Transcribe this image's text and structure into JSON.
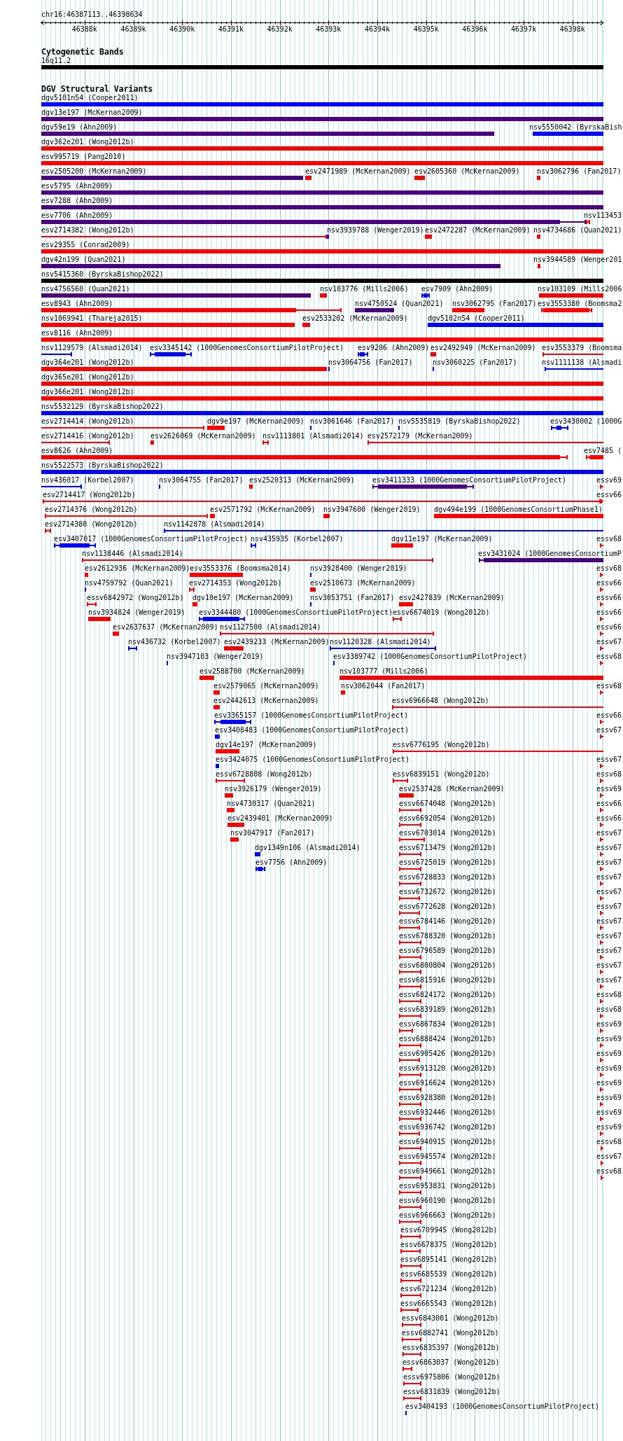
{
  "locus": "chr16:46387113..46398634",
  "ruler_ticks": [
    "46388k",
    "46389k",
    "46390k",
    "46391k",
    "46392k",
    "46393k",
    "46394k",
    "46395k",
    "46396k",
    "46397k",
    "46398k"
  ],
  "tracks": [
    {
      "title": "Cytogenetic Bands",
      "rows": [
        [
          {
            "label": "16q11.2",
            "color": "#000000",
            "kind": "bar"
          }
        ]
      ]
    },
    {
      "title": "DGV Structural Variants",
      "rows": [
        [
          {
            "label": "dgv5101n54 (Cooper2011)",
            "color": "#0000ff",
            "kind": "bar"
          }
        ],
        [
          {
            "label": "dgv13e197 (McKernan2009)",
            "color": "#4b0082",
            "kind": "bar"
          }
        ],
        [
          {
            "label": "dgv59e19 (Ahn2009)",
            "color": "#4b0082",
            "kind": "bar"
          },
          {
            "label": "nsv5550042 (ByrskaBish",
            "color": "#0000ff",
            "kind": "bar"
          }
        ],
        [
          {
            "label": "dgv362e201 (Wong2012b)",
            "color": "#ff0000",
            "kind": "bar"
          }
        ],
        [
          {
            "label": "esv995719 (Pang2010)",
            "color": "#ff0000",
            "kind": "bar"
          }
        ],
        [
          {
            "label": "esv2505200 (McKernan2009)",
            "color": "#4b0082",
            "kind": "bar"
          },
          {
            "label": "esv2471989 (McKernan2009)",
            "color": "#ff0000",
            "kind": "bar"
          },
          {
            "label": "esv2605360 (McKernan2009)",
            "color": "#ff0000",
            "kind": "bar"
          },
          {
            "label": "nsv3062796 (Fan2017)",
            "color": "#ff0000",
            "kind": "bar"
          }
        ],
        [
          {
            "label": "esv5795 (Ahn2009)",
            "color": "#4b0082",
            "kind": "bar"
          }
        ],
        [
          {
            "label": "esv7288 (Ahn2009)",
            "color": "#4b0082",
            "kind": "bar"
          }
        ],
        [
          {
            "label": "esv7706 (Ahn2009)",
            "color": "#4b0082",
            "kind": "mixed"
          },
          {
            "label": "nsv113453",
            "color": "#ff0000",
            "kind": "span"
          }
        ],
        [
          {
            "label": "esv2714382 (Wong2012b)",
            "color": "#ff0000",
            "kind": "span"
          },
          {
            "label": "nsv3939788 (Wenger2019)",
            "color": "#0000ff",
            "kind": "bar"
          },
          {
            "label": "esv2472287 (McKernan2009)",
            "color": "#ff0000",
            "kind": "bar"
          },
          {
            "label": "nsv4734686 (Quan2021)",
            "color": "#ff0000",
            "kind": "bar"
          }
        ],
        [
          {
            "label": "esv29355 (Conrad2009)",
            "color": "#ff0000",
            "kind": "bar"
          }
        ],
        [
          {
            "label": "dgv42n199 (Quan2021)",
            "color": "#4b0082",
            "kind": "bar"
          },
          {
            "label": "nsv3944589 (Wenger201",
            "color": "#ff0000",
            "kind": "bar"
          }
        ],
        [
          {
            "label": "nsv5415360 (ByrskaBishop2022)",
            "color": "#000000",
            "kind": "bar"
          }
        ],
        [
          {
            "label": "nsv4756560 (Quan2021)",
            "color": "#4b0082",
            "kind": "bar"
          },
          {
            "label": "nsv103776 (Mills2006)",
            "color": "#ff0000",
            "kind": "bar"
          },
          {
            "label": "esv7909 (Ahn2009)",
            "color": "#0000ff",
            "kind": "mixed"
          },
          {
            "label": "nsv103109 (Mills2006",
            "color": "#ff0000",
            "kind": "bar"
          }
        ],
        [
          {
            "label": "esv8943 (Ahn2009)",
            "color": "#ff0000",
            "kind": "mixed"
          },
          {
            "label": "nsv4750524 (Quan2021)",
            "color": "#4b0082",
            "kind": "bar"
          },
          {
            "label": "nsv3062795 (Fan2017)",
            "color": "#ff0000",
            "kind": "bar"
          },
          {
            "label": "esv3553380 (Boomsma2",
            "color": "#ff0000",
            "kind": "mixed"
          }
        ],
        [
          {
            "label": "nsv1069941 (Thareja2015)",
            "color": "#ff0000",
            "kind": "bar"
          },
          {
            "label": "esv2533202 (McKernan2009)",
            "color": "#ff0000",
            "kind": "bar"
          },
          {
            "label": "dgv5102n54 (Cooper2011)",
            "color": "#0000ff",
            "kind": "bar"
          }
        ],
        [
          {
            "label": "esv8116 (Ahn2009)",
            "color": "#ff0000",
            "kind": "bar"
          }
        ],
        [
          {
            "label": "nsv1129579 (Alsmadi2014)",
            "color": "#0000ff",
            "kind": "span"
          },
          {
            "label": "esv3345142 (1000GenomesConsortiumPilotProject)",
            "color": "#0000ff",
            "kind": "mixed"
          },
          {
            "label": "esv9206 (Ahn2009)",
            "color": "#0000ff",
            "kind": "mixed"
          },
          {
            "label": "esv2492949 (McKernan2009)",
            "color": "#ff0000",
            "kind": "bar"
          },
          {
            "label": "esv3553379 (Boomsma",
            "color": "#ff0000",
            "kind": "span"
          }
        ],
        [
          {
            "label": "dgv364e201 (Wong2012b)",
            "color": "#ff0000",
            "kind": "bar"
          },
          {
            "label": "nsv3064756 (Fan2017)",
            "color": "#0000ff",
            "kind": "bar"
          },
          {
            "label": "nsv3060225 (Fan2017)",
            "color": "#0000ff",
            "kind": "bar"
          },
          {
            "label": "nsv1111138 (Alsmadi",
            "color": "#0000ff",
            "kind": "span"
          }
        ],
        [
          {
            "label": "dgv365e201 (Wong2012b)",
            "color": "#ff0000",
            "kind": "bar"
          }
        ],
        [
          {
            "label": "dgv366e201 (Wong2012b)",
            "color": "#ff0000",
            "kind": "bar"
          }
        ],
        [
          {
            "label": "nsv5532129 (ByrskaBishop2022)",
            "color": "#0000ff",
            "kind": "bar"
          }
        ],
        [
          {
            "label": "esv2714414 (Wong2012b)",
            "color": "#ff0000",
            "kind": "span"
          },
          {
            "label": "dgv9e197 (McKernan2009)",
            "color": "#ff0000",
            "kind": "bar"
          },
          {
            "label": "nsv3061646 (Fan2017)",
            "color": "#0000ff",
            "kind": "bar"
          },
          {
            "label": "nsv5535819 (ByrskaBishop2022)",
            "color": "#0000ff",
            "kind": "bar"
          },
          {
            "label": "esv3430002 (1000G",
            "color": "#0000ff",
            "kind": "mixed"
          }
        ],
        [
          {
            "label": "esv2714416 (Wong2012b)",
            "color": "#ff0000",
            "kind": "span"
          },
          {
            "label": "esv2626069 (McKernan2009)",
            "color": "#ff0000",
            "kind": "bar"
          },
          {
            "label": "nsv1113801 (Alsmadi2014)",
            "color": "#ff0000",
            "kind": "span"
          },
          {
            "label": "esv2572179 (McKernan2009)",
            "color": "#ff0000",
            "kind": "span"
          }
        ],
        [
          {
            "label": "esv8626 (Ahn2009)",
            "color": "#ff0000",
            "kind": "mixed"
          },
          {
            "label": "esv7485 (",
            "color": "#ff0000",
            "kind": "mixed"
          }
        ],
        [
          {
            "label": "nsv5522573 (ByrskaBishop2022)",
            "color": "#0000ff",
            "kind": "bar"
          }
        ],
        [
          {
            "label": "nsv436017 (Korbel2007)",
            "color": "#0000ff",
            "kind": "span"
          },
          {
            "label": "nsv3064755 (Fan2017)",
            "color": "#0000ff",
            "kind": "bar"
          },
          {
            "label": "esv2520313 (McKernan2009)",
            "color": "#ff0000",
            "kind": "bar"
          },
          {
            "label": "esv3411333 (1000GenomesConsortiumPilotProject)",
            "color": "#4b0082",
            "kind": "mixed"
          },
          {
            "label": "essv69",
            "color": "#ff0000",
            "kind": "span"
          }
        ],
        [
          {
            "label": "esv2714417 (Wong2012b)",
            "color": "#ff0000",
            "kind": "span"
          },
          {
            "label": "essv66",
            "color": "#ff0000",
            "kind": "span"
          }
        ],
        [
          {
            "label": "esv2714376 (Wong2012b)",
            "color": "#ff0000",
            "kind": "span"
          },
          {
            "label": "esv2571792 (McKernan2009)",
            "color": "#ff0000",
            "kind": "bar"
          },
          {
            "label": "nsv3947600 (Wenger2019)",
            "color": "#ff0000",
            "kind": "bar"
          },
          {
            "label": "dgv494e199 (1000GenomesConsortiumPhase1)",
            "color": "#ff0000",
            "kind": "bar"
          }
        ],
        [
          {
            "label": "esv2714380 (Wong2012b)",
            "color": "#ff0000",
            "kind": "span"
          },
          {
            "label": "nsv1142878 (Alsmadi2014)",
            "color": "#0000ff",
            "kind": "span"
          }
        ],
        [
          {
            "label": "esv3407017 (1000GenomesConsortiumPilotProject)",
            "color": "#0000ff",
            "kind": "mixed"
          },
          {
            "label": "nsv435935 (Korbel2007)",
            "color": "#0000ff",
            "kind": "span"
          },
          {
            "label": "dgv11e197 (McKernan2009)",
            "color": "#ff0000",
            "kind": "bar"
          },
          {
            "label": "essv68",
            "color": "#ff0000",
            "kind": "span"
          }
        ],
        [
          {
            "label": "nsv1138446 (Alsmadi2014)",
            "color": "#ff0000",
            "kind": "span"
          },
          {
            "label": "esv3431024 (1000GenomesConsortiumP",
            "color": "#4b0082",
            "kind": "mixed"
          }
        ],
        [
          {
            "label": "esv2612936 (McKernan2009)",
            "color": "#ff0000",
            "kind": "bar"
          },
          {
            "label": "esv3553376 (Boomsma2014)",
            "color": "#ff0000",
            "kind": "bar"
          },
          {
            "label": "nsv3928400 (Wenger2019)",
            "color": "#0000ff",
            "kind": "bar"
          },
          {
            "label": "essv68",
            "color": "#ff0000",
            "kind": "span"
          }
        ],
        [
          {
            "label": "nsv4759792 (Quan2021)",
            "color": "#0000ff",
            "kind": "bar"
          },
          {
            "label": "esv2714353 (Wong2012b)",
            "color": "#ff0000",
            "kind": "span"
          },
          {
            "label": "esv2510673 (McKernan2009)",
            "color": "#ff0000",
            "kind": "bar"
          },
          {
            "label": "essv66",
            "color": "#ff0000",
            "kind": "span"
          }
        ],
        [
          {
            "label": "essv6842972 (Wong2012b)",
            "color": "#ff0000",
            "kind": "span"
          },
          {
            "label": "dgv10e197 (McKernan2009)",
            "color": "#ff0000",
            "kind": "bar"
          },
          {
            "label": "nsv3053751 (Fan2017)",
            "color": "#0000ff",
            "kind": "bar"
          },
          {
            "label": "esv2427839 (McKernan2009)",
            "color": "#ff0000",
            "kind": "bar"
          },
          {
            "label": "essv66",
            "color": "#ff0000",
            "kind": "span"
          }
        ],
        [
          {
            "label": "nsv3934824 (Wenger2019)",
            "color": "#ff0000",
            "kind": "bar"
          },
          {
            "label": "esv3344480 (1000GenomesConsortiumPilotProject)",
            "color": "#0000ff",
            "kind": "mixed"
          },
          {
            "label": "essv6674019 (Wong2012b)",
            "color": "#ff0000",
            "kind": "span"
          },
          {
            "label": "essv66",
            "color": "#ff0000",
            "kind": "span"
          }
        ],
        [
          {
            "label": "esv2637637 (McKernan2009)",
            "color": "#ff0000",
            "kind": "bar"
          },
          {
            "label": "nsv1127500 (Alsmadi2014)",
            "color": "#ff0000",
            "kind": "span"
          },
          {
            "label": "essv66",
            "color": "#ff0000",
            "kind": "span"
          }
        ],
        [
          {
            "label": "nsv436732 (Korbel2007)",
            "color": "#0000ff",
            "kind": "span"
          },
          {
            "label": "esv2439233 (McKernan2009)",
            "color": "#ff0000",
            "kind": "bar"
          },
          {
            "label": "nsv1120328 (Alsmadi2014)",
            "color": "#0000ff",
            "kind": "span"
          },
          {
            "label": "essv67",
            "color": "#ff0000",
            "kind": "span"
          }
        ],
        [
          {
            "label": "nsv3947103 (Wenger2019)",
            "color": "#0000ff",
            "kind": "bar"
          },
          {
            "label": "esv3389742 (1000GenomesConsortiumPilotProject)",
            "color": "#0000ff",
            "kind": "bar"
          },
          {
            "label": "essv68",
            "color": "#ff0000",
            "kind": "span"
          }
        ],
        [
          {
            "label": "esv2588700 (McKernan2009)",
            "color": "#ff0000",
            "kind": "bar"
          },
          {
            "label": "nsv103777 (Mills2006)",
            "color": "#ff0000",
            "kind": "bar"
          }
        ],
        [
          {
            "label": "esv2579065 (McKernan2009)",
            "color": "#ff0000",
            "kind": "bar"
          },
          {
            "label": "nsv3062044 (Fan2017)",
            "color": "#ff0000",
            "kind": "bar"
          },
          {
            "label": "essv68",
            "color": "#ff0000",
            "kind": "span"
          }
        ],
        [
          {
            "label": "esv2442613 (McKernan2009)",
            "color": "#ff0000",
            "kind": "bar"
          },
          {
            "label": "essv6966648 (Wong2012b)",
            "color": "#ff0000",
            "kind": "span"
          }
        ],
        [
          {
            "label": "esv3365157 (1000GenomesConsortiumPilotProject)",
            "color": "#0000ff",
            "kind": "mixed"
          },
          {
            "label": "essv66",
            "color": "#ff0000",
            "kind": "span"
          }
        ],
        [
          {
            "label": "esv3408483 (1000GenomesConsortiumPilotProject)",
            "color": "#0000ff",
            "kind": "mixed"
          },
          {
            "label": "essv67",
            "color": "#ff0000",
            "kind": "span"
          }
        ],
        [
          {
            "label": "dgv14e197 (McKernan2009)",
            "color": "#ff0000",
            "kind": "bar"
          },
          {
            "label": "essv6776195 (Wong2012b)",
            "color": "#ff0000",
            "kind": "span"
          }
        ],
        [
          {
            "label": "esv3424075 (1000GenomesConsortiumPilotProject)",
            "color": "#0000ff",
            "kind": "bar"
          },
          {
            "label": "essv67",
            "color": "#ff0000",
            "kind": "span"
          }
        ],
        [
          {
            "label": "essv6728808 (Wong2012b)",
            "color": "#ff0000",
            "kind": "span"
          },
          {
            "label": "essv6839151 (Wong2012b)",
            "color": "#ff0000",
            "kind": "span"
          },
          {
            "label": "essv68",
            "color": "#ff0000",
            "kind": "span"
          }
        ],
        [
          {
            "label": "nsv3926179 (Wenger2019)",
            "color": "#ff0000",
            "kind": "bar"
          },
          {
            "label": "esv2537428 (McKernan2009)",
            "color": "#ff0000",
            "kind": "bar"
          },
          {
            "label": "essv69",
            "color": "#ff0000",
            "kind": "span"
          }
        ],
        [
          {
            "label": "nsv4730317 (Quan2021)",
            "color": "#ff0000",
            "kind": "bar"
          },
          {
            "label": "essv6674048 (Wong2012b)",
            "color": "#ff0000",
            "kind": "span"
          },
          {
            "label": "essv66",
            "color": "#ff0000",
            "kind": "span"
          }
        ],
        [
          {
            "label": "esv2439401 (McKernan2009)",
            "color": "#ff0000",
            "kind": "bar"
          },
          {
            "label": "essv6692054 (Wong2012b)",
            "color": "#ff0000",
            "kind": "span"
          },
          {
            "label": "essv66",
            "color": "#ff0000",
            "kind": "span"
          }
        ],
        [
          {
            "label": "nsv3047917 (Fan2017)",
            "color": "#ff0000",
            "kind": "bar"
          },
          {
            "label": "essv6703014 (Wong2012b)",
            "color": "#ff0000",
            "kind": "span"
          },
          {
            "label": "essv67",
            "color": "#ff0000",
            "kind": "span"
          }
        ],
        [
          {
            "label": "dgv1349n106 (Alsmadi2014)",
            "color": "#0000ff",
            "kind": "bar"
          },
          {
            "label": "essv6713479 (Wong2012b)",
            "color": "#ff0000",
            "kind": "span"
          },
          {
            "label": "essv67",
            "color": "#ff0000",
            "kind": "span"
          }
        ],
        [
          {
            "label": "esv7756 (Ahn2009)",
            "color": "#0000ff",
            "kind": "mixed"
          },
          {
            "label": "essv6725019 (Wong2012b)",
            "color": "#ff0000",
            "kind": "span"
          },
          {
            "label": "essv67",
            "color": "#ff0000",
            "kind": "span"
          }
        ],
        [
          {
            "label": "essv6728833 (Wong2012b)",
            "color": "#ff0000",
            "kind": "span"
          },
          {
            "label": "essv67",
            "color": "#ff0000",
            "kind": "span"
          }
        ],
        [
          {
            "label": "essv6732672 (Wong2012b)",
            "color": "#ff0000",
            "kind": "span"
          },
          {
            "label": "essv67",
            "color": "#ff0000",
            "kind": "span"
          }
        ],
        [
          {
            "label": "essv6772628 (Wong2012b)",
            "color": "#ff0000",
            "kind": "span"
          },
          {
            "label": "essv67",
            "color": "#ff0000",
            "kind": "span"
          }
        ],
        [
          {
            "label": "essv6784146 (Wong2012b)",
            "color": "#ff0000",
            "kind": "span"
          },
          {
            "label": "essv67",
            "color": "#ff0000",
            "kind": "span"
          }
        ],
        [
          {
            "label": "essv6788320 (Wong2012b)",
            "color": "#ff0000",
            "kind": "span"
          },
          {
            "label": "essv67",
            "color": "#ff0000",
            "kind": "span"
          }
        ],
        [
          {
            "label": "essv6796589 (Wong2012b)",
            "color": "#ff0000",
            "kind": "span"
          },
          {
            "label": "essv67",
            "color": "#ff0000",
            "kind": "span"
          }
        ],
        [
          {
            "label": "essv6800804 (Wong2012b)",
            "color": "#ff0000",
            "kind": "span"
          },
          {
            "label": "essv67",
            "color": "#ff0000",
            "kind": "span"
          }
        ],
        [
          {
            "label": "essv6815916 (Wong2012b)",
            "color": "#ff0000",
            "kind": "span"
          },
          {
            "label": "essv67",
            "color": "#ff0000",
            "kind": "span"
          }
        ],
        [
          {
            "label": "essv6824172 (Wong2012b)",
            "color": "#ff0000",
            "kind": "span"
          },
          {
            "label": "essv68",
            "color": "#ff0000",
            "kind": "span"
          }
        ],
        [
          {
            "label": "essv6839189 (Wong2012b)",
            "color": "#ff0000",
            "kind": "span"
          },
          {
            "label": "essv68",
            "color": "#ff0000",
            "kind": "span"
          }
        ],
        [
          {
            "label": "essv6867834 (Wong2012b)",
            "color": "#ff0000",
            "kind": "span"
          },
          {
            "label": "essv69",
            "color": "#ff0000",
            "kind": "span"
          }
        ],
        [
          {
            "label": "essv6888424 (Wong2012b)",
            "color": "#ff0000",
            "kind": "span"
          },
          {
            "label": "essv69",
            "color": "#ff0000",
            "kind": "span"
          }
        ],
        [
          {
            "label": "essv6905426 (Wong2012b)",
            "color": "#ff0000",
            "kind": "span"
          },
          {
            "label": "essv69",
            "color": "#ff0000",
            "kind": "span"
          }
        ],
        [
          {
            "label": "essv6913120 (Wong2012b)",
            "color": "#ff0000",
            "kind": "span"
          },
          {
            "label": "essv69",
            "color": "#ff0000",
            "kind": "span"
          }
        ],
        [
          {
            "label": "essv6916624 (Wong2012b)",
            "color": "#ff0000",
            "kind": "span"
          },
          {
            "label": "essv69",
            "color": "#ff0000",
            "kind": "span"
          }
        ],
        [
          {
            "label": "essv6928380 (Wong2012b)",
            "color": "#ff0000",
            "kind": "span"
          },
          {
            "label": "essv69",
            "color": "#ff0000",
            "kind": "span"
          }
        ],
        [
          {
            "label": "essv6932446 (Wong2012b)",
            "color": "#ff0000",
            "kind": "span"
          },
          {
            "label": "essv69",
            "color": "#ff0000",
            "kind": "span"
          }
        ],
        [
          {
            "label": "essv6936742 (Wong2012b)",
            "color": "#ff0000",
            "kind": "span"
          },
          {
            "label": "essv69",
            "color": "#ff0000",
            "kind": "span"
          }
        ],
        [
          {
            "label": "essv6940915 (Wong2012b)",
            "color": "#ff0000",
            "kind": "span"
          },
          {
            "label": "essv68",
            "color": "#ff0000",
            "kind": "span"
          }
        ],
        [
          {
            "label": "essv6945574 (Wong2012b)",
            "color": "#ff0000",
            "kind": "span"
          },
          {
            "label": "essv67",
            "color": "#ff0000",
            "kind": "span"
          }
        ],
        [
          {
            "label": "essv6949661 (Wong2012b)",
            "color": "#ff0000",
            "kind": "span"
          },
          {
            "label": "essv68",
            "color": "#ff0000",
            "kind": "span"
          }
        ],
        [
          {
            "label": "essv6953831 (Wong2012b)",
            "color": "#ff0000",
            "kind": "span"
          }
        ],
        [
          {
            "label": "essv6960190 (Wong2012b)",
            "color": "#ff0000",
            "kind": "span"
          }
        ],
        [
          {
            "label": "essv6966663 (Wong2012b)",
            "color": "#ff0000",
            "kind": "span"
          }
        ],
        [
          {
            "label": "essv6709945 (Wong2012b)",
            "color": "#ff0000",
            "kind": "span"
          }
        ],
        [
          {
            "label": "essv6678375 (Wong2012b)",
            "color": "#ff0000",
            "kind": "span"
          }
        ],
        [
          {
            "label": "essv6895141 (Wong2012b)",
            "color": "#ff0000",
            "kind": "span"
          }
        ],
        [
          {
            "label": "essv6685539 (Wong2012b)",
            "color": "#ff0000",
            "kind": "span"
          }
        ],
        [
          {
            "label": "essv6721234 (Wong2012b)",
            "color": "#ff0000",
            "kind": "span"
          }
        ],
        [
          {
            "label": "essv6665543 (Wong2012b)",
            "color": "#ff0000",
            "kind": "span"
          }
        ],
        [
          {
            "label": "essv6843001 (Wong2012b)",
            "color": "#ff0000",
            "kind": "span"
          }
        ],
        [
          {
            "label": "essv6882741 (Wong2012b)",
            "color": "#ff0000",
            "kind": "span"
          }
        ],
        [
          {
            "label": "essv6835397 (Wong2012b)",
            "color": "#ff0000",
            "kind": "span"
          }
        ],
        [
          {
            "label": "essv6863037 (Wong2012b)",
            "color": "#ff0000",
            "kind": "span"
          }
        ],
        [
          {
            "label": "essv6975806 (Wong2012b)",
            "color": "#ff0000",
            "kind": "span"
          }
        ],
        [
          {
            "label": "essv6831839 (Wong2012b)",
            "color": "#ff0000",
            "kind": "span"
          }
        ],
        [
          {
            "label": "esv3404193 (1000GenomesConsortiumPilotProject)",
            "color": "#0000ff",
            "kind": "bar"
          }
        ]
      ]
    }
  ]
}
